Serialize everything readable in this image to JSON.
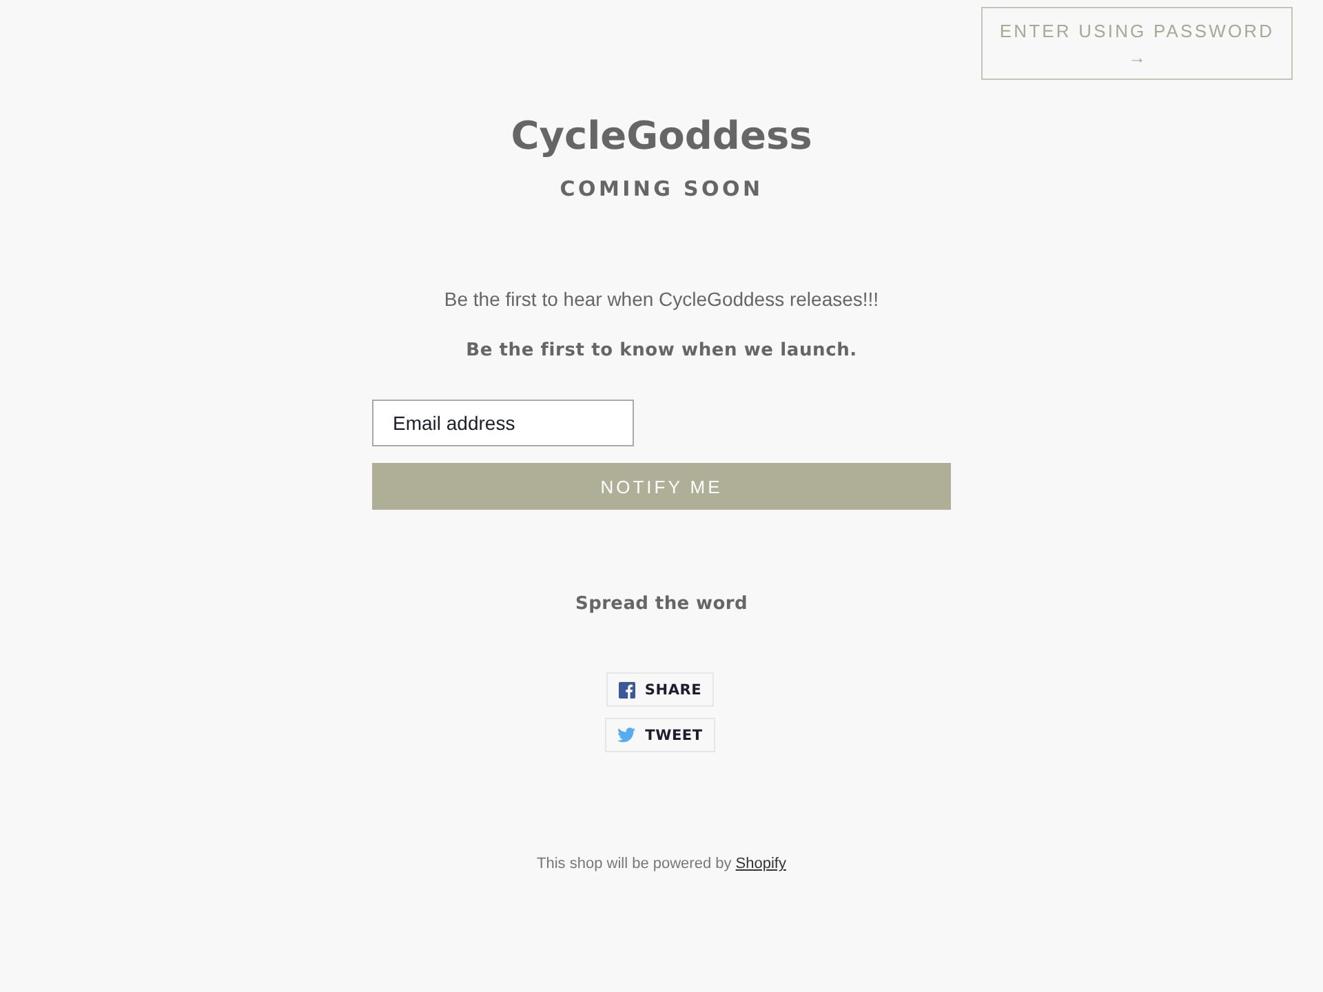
{
  "password_button": {
    "label": "ENTER USING PASSWORD",
    "arrow": "→"
  },
  "header": {
    "title": "CycleGoddess",
    "subtitle": "COMING SOON"
  },
  "signup": {
    "message": "Be the first to hear when CycleGoddess releases!!!",
    "prompt": "Be the first to know when we launch.",
    "email_field": {
      "placeholder": "Email address"
    },
    "submit_button": "NOTIFY ME"
  },
  "share": {
    "heading": "Spread the word",
    "buttons": [
      {
        "kind": "facebook",
        "label": "SHARE"
      },
      {
        "kind": "twitter",
        "label": "TWEET"
      }
    ]
  },
  "footer": {
    "text": "This shop will be powered by",
    "link": "Shopify"
  }
}
